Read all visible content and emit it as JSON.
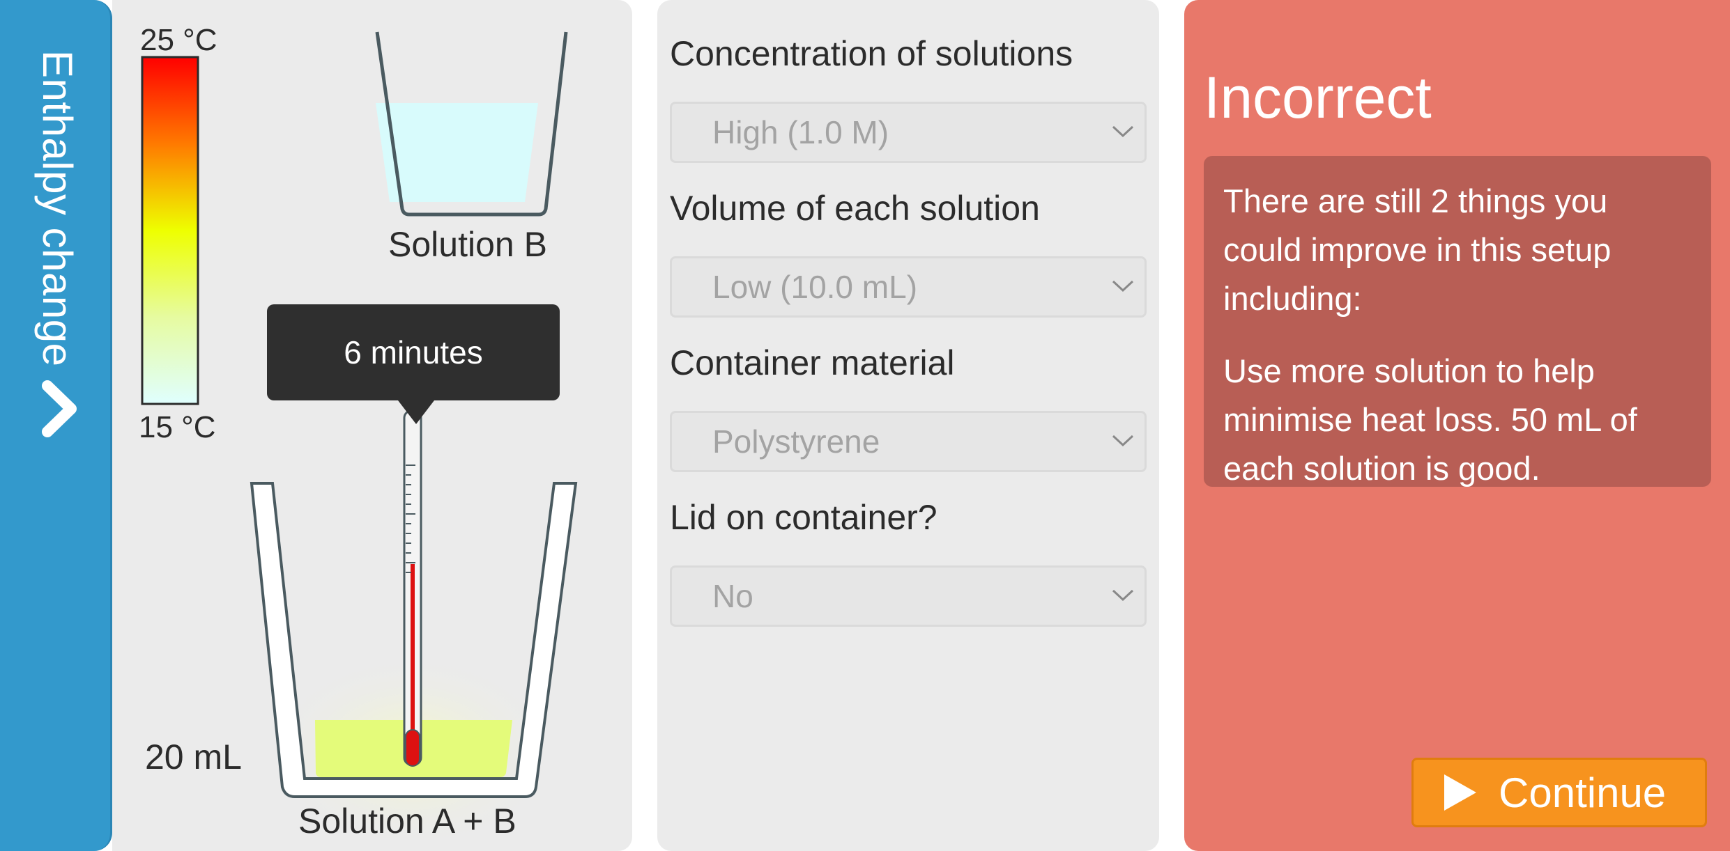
{
  "sidebar": {
    "label": "Enthalpy change",
    "toggle_icon": "chevron-right-icon",
    "color": "#3399cc"
  },
  "simulation": {
    "scale_max": "25 °C",
    "scale_min": "15 °C",
    "solution_b_label": "Solution B",
    "mixture_label": "Solution A + B",
    "volume_label": "20 mL",
    "timer_text": "6 minutes",
    "colors": {
      "scale_top": "#ff0000",
      "scale_mid": "#eeff00",
      "scale_bottom": "#e0ffff",
      "solution_b": "#d8fbfc",
      "mixture": "#e4fb7a",
      "thermometer_liquid": "#dd1111"
    }
  },
  "options": [
    {
      "label": "Concentration of solutions",
      "value": "High (1.0 M)",
      "icon": "chevron-down-icon"
    },
    {
      "label": "Volume of each solution",
      "value": "Low (10.0 mL)",
      "icon": "chevron-down-icon"
    },
    {
      "label": "Container material",
      "value": "Polystyrene",
      "icon": "chevron-down-icon"
    },
    {
      "label": "Lid on container?",
      "value": "No",
      "icon": "chevron-down-icon"
    }
  ],
  "feedback": {
    "title": "Incorrect",
    "summary": "There are still 2 things you could improve in this setup including:",
    "tip": "Use more solution to help minimise heat loss. 50 mL of each solution is good.",
    "continue_label": "Continue",
    "continue_icon": "play-icon",
    "colors": {
      "panel": "#e8786a",
      "box": "#b85e55",
      "button": "#f7931e"
    }
  }
}
